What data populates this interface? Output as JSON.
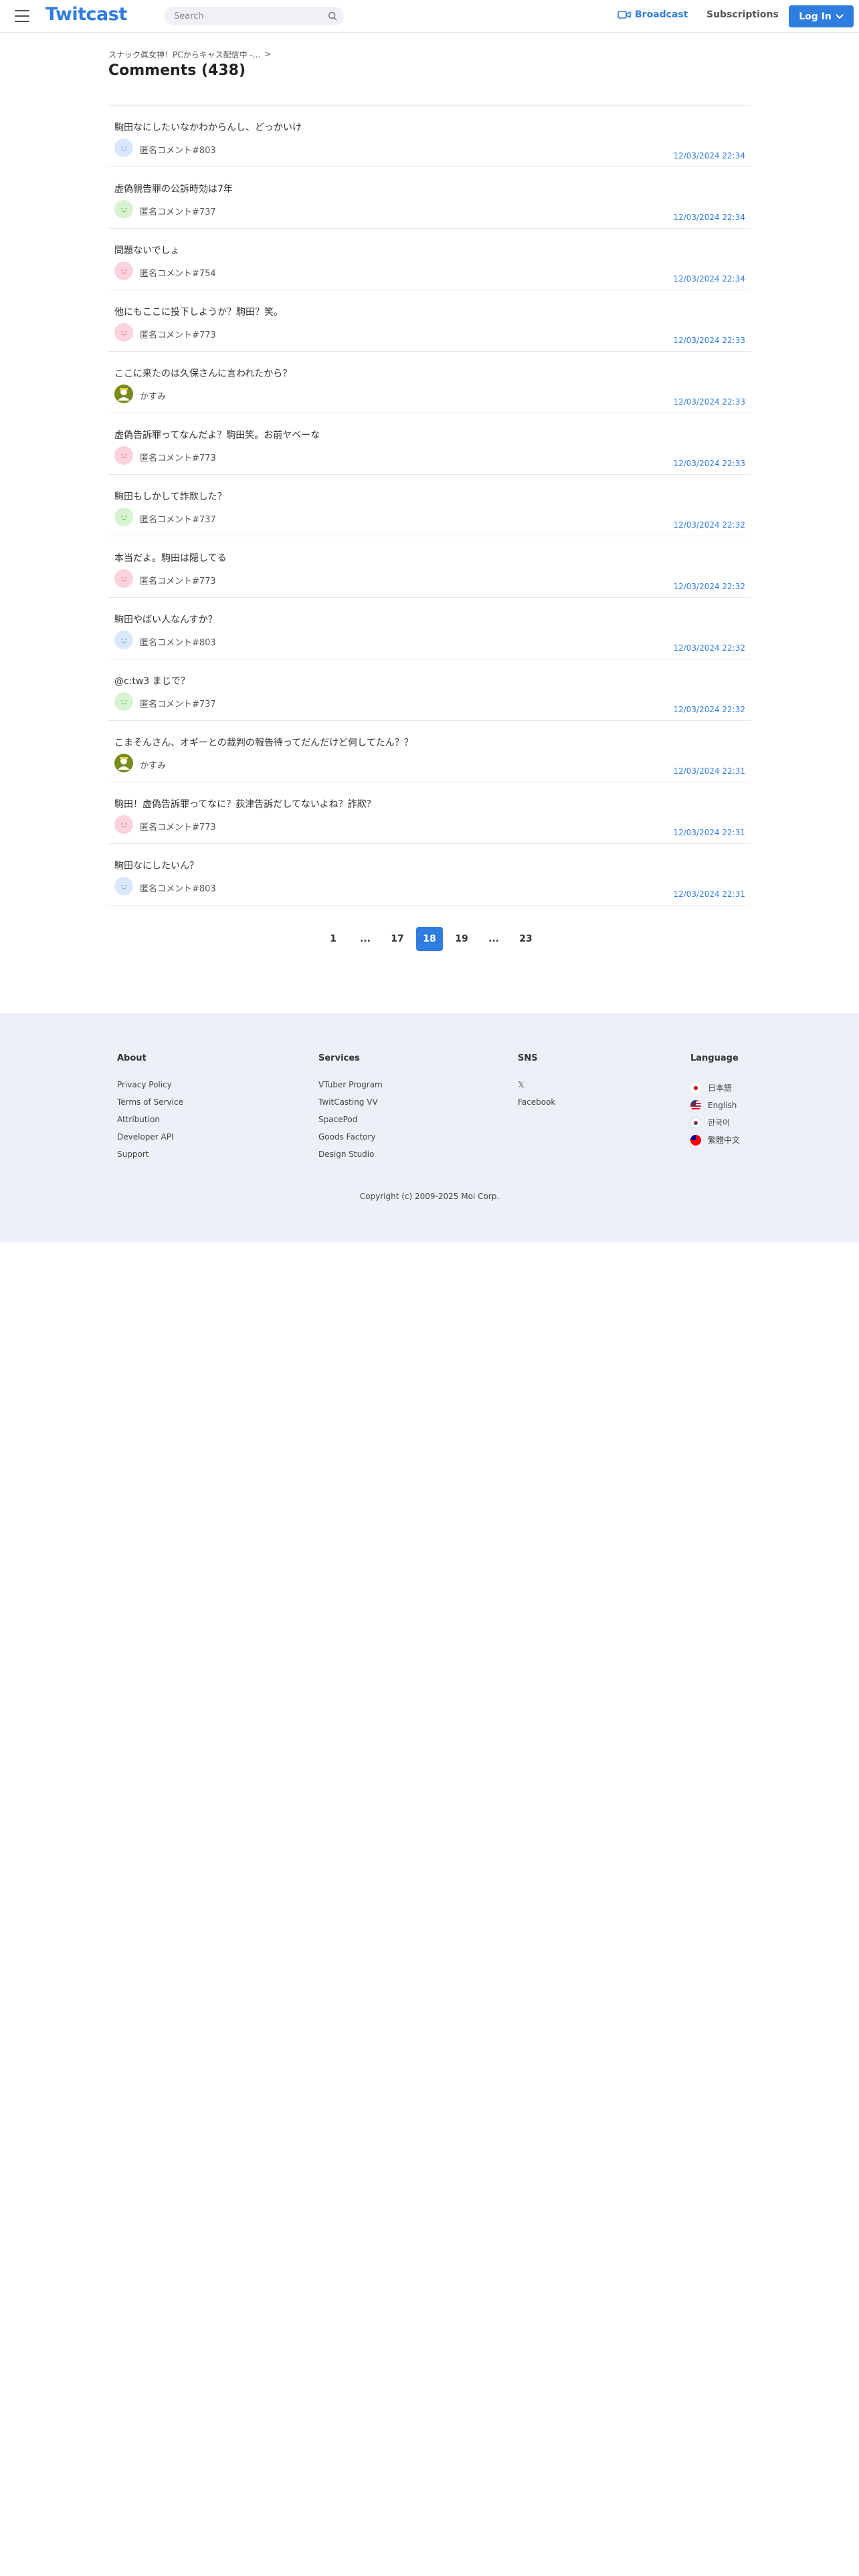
{
  "header": {
    "logo": "Twitcast",
    "search_placeholder": "Search",
    "broadcast_label": "Broadcast",
    "subscriptions_label": "Subscriptions",
    "login_label": "Log In"
  },
  "breadcrumb": {
    "text": "スナック眞女神！PCからキャス配信中 -...",
    "separator": ">"
  },
  "page_title": "Comments (438)",
  "comments": [
    {
      "text": "駒田なにしたいなかわからんし、どっかいけ",
      "author": "匿名コメント#803",
      "time": "12/03/2024 22:34",
      "avatar": "blue"
    },
    {
      "text": "虚偽親告罪の公訴時効は7年",
      "author": "匿名コメント#737",
      "time": "12/03/2024 22:34",
      "avatar": "green"
    },
    {
      "text": "問題ないでしょ",
      "author": "匿名コメント#754",
      "time": "12/03/2024 22:34",
      "avatar": "pink"
    },
    {
      "text": "他にもここに投下しようか？駒田？笑。",
      "author": "匿名コメント#773",
      "time": "12/03/2024 22:33",
      "avatar": "pink"
    },
    {
      "text": "ここに来たのは久保さんに言われたから？",
      "author": "かすみ",
      "time": "12/03/2024 22:33",
      "avatar": "user"
    },
    {
      "text": "虚偽告訴罪ってなんだよ？駒田笑。お前ヤベーな",
      "author": "匿名コメント#773",
      "time": "12/03/2024 22:33",
      "avatar": "pink"
    },
    {
      "text": "駒田もしかして詐欺した？",
      "author": "匿名コメント#737",
      "time": "12/03/2024 22:32",
      "avatar": "green"
    },
    {
      "text": "本当だよ。駒田は隠してる",
      "author": "匿名コメント#773",
      "time": "12/03/2024 22:32",
      "avatar": "pink"
    },
    {
      "text": "駒田やばい人なんすか？",
      "author": "匿名コメント#803",
      "time": "12/03/2024 22:32",
      "avatar": "blue"
    },
    {
      "text": "@c:tw3 まじで？",
      "author": "匿名コメント#737",
      "time": "12/03/2024 22:32",
      "avatar": "green"
    },
    {
      "text": "こまそんさん、オギーとの裁判の報告待ってだんだけど何してたん？？",
      "author": "かすみ",
      "time": "12/03/2024 22:31",
      "avatar": "user"
    },
    {
      "text": "駒田！虚偽告訴罪ってなに？荻津告訴だしてないよね？詐欺？",
      "author": "匿名コメント#773",
      "time": "12/03/2024 22:31",
      "avatar": "pink"
    },
    {
      "text": "駒田なにしたいん？",
      "author": "匿名コメント#803",
      "time": "12/03/2024 22:31",
      "avatar": "blue"
    }
  ],
  "pagination": [
    "1",
    "...",
    "17",
    "18",
    "19",
    "...",
    "23"
  ],
  "pagination_active": "18",
  "footer": {
    "about": {
      "title": "About",
      "links": [
        "Privacy Policy",
        "Terms of Service",
        "Attribution",
        "Developer API",
        "Support"
      ]
    },
    "services": {
      "title": "Services",
      "links": [
        "VTuber Program",
        "TwitCasting VV",
        "SpacePod",
        "Goods Factory",
        "Design Studio"
      ]
    },
    "sns": {
      "title": "SNS",
      "links": [
        "𝕏",
        "Facebook"
      ]
    },
    "language": {
      "title": "Language",
      "links": [
        "日本語",
        "English",
        "한국어",
        "繁體中文"
      ]
    },
    "copyright": "Copyright (c) 2009-2025 Moi Corp."
  },
  "colors": {
    "accent": "#2f7ddf",
    "footer_bg": "#edf0f6"
  }
}
